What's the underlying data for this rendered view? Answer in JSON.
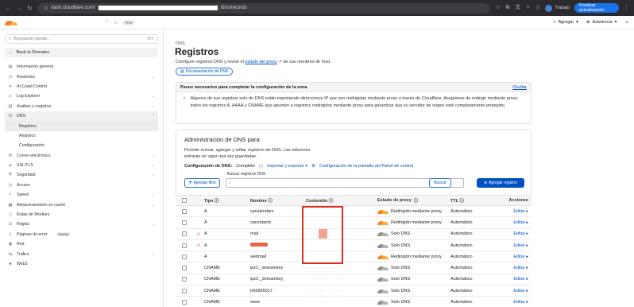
{
  "browser": {
    "url": "dash.cloudflare.com/",
    "url_suffix": "/dns/records",
    "profile": "Trabajo",
    "update_button": "Finalizar actualización"
  },
  "topbar": {
    "plan_badge": "Free",
    "add_label": "Agregar",
    "support_label": "Asistencia"
  },
  "sidebar": {
    "search_placeholder": "Búsqueda rápida...",
    "search_shortcut": "⌘K",
    "back_label": "Back to Domains",
    "items": [
      {
        "label": "Información general",
        "icon": "doc-icon"
      },
      {
        "label": "Recientes",
        "icon": "clock-icon",
        "chevron": true
      },
      {
        "label": "AI Crawl Control",
        "icon": "ai-icon"
      },
      {
        "label": "Log Explorer",
        "icon": "log-icon",
        "chevron": true
      },
      {
        "label": "Análisis y registros",
        "icon": "chart-icon",
        "chevron": true
      },
      {
        "label": "DNS",
        "icon": "dns-icon",
        "chevron": true
      }
    ],
    "dns_sub": [
      "Registros",
      "Analytics",
      "Configuración"
    ],
    "items2": [
      {
        "label": "Correo electrónico",
        "icon": "mail-icon",
        "chevron": true
      },
      {
        "label": "SSL/TLS",
        "icon": "lock-icon",
        "chevron": true
      },
      {
        "label": "Seguridad",
        "icon": "shield-icon",
        "chevron": true
      },
      {
        "label": "Acceso",
        "icon": "access-icon"
      },
      {
        "label": "Speed",
        "icon": "speed-icon",
        "chevron": true
      },
      {
        "label": "Almacenamiento en caché",
        "icon": "cache-icon",
        "chevron": true
      },
      {
        "label": "Rutas de Workers",
        "icon": "workers-icon"
      },
      {
        "label": "Reglas",
        "icon": "rules-icon",
        "chevron": true
      },
      {
        "label": "Páginas de error",
        "icon": "error-icon",
        "badge": "Nuevo"
      },
      {
        "label": "Red",
        "icon": "network-icon"
      },
      {
        "label": "Tráfico",
        "icon": "traffic-icon",
        "chevron": true
      },
      {
        "label": "Web3",
        "icon": "web3-icon"
      }
    ]
  },
  "main": {
    "breadcrumb": "DNS",
    "title": "Registros",
    "subtitle_pre": "Configure registros DNS y revise el",
    "subtitle_link": "estado del proxy",
    "subtitle_post": "de sus nombres de host.",
    "doc_button": "Documentación de DNS",
    "notice": {
      "title": "Pasos necesarios para completar la configuración de la zona",
      "hide": "Ocultar",
      "body": "Algunos de sus registros solo de DNS están exponiendo direcciones IP que son redirigidas mediante proxy a través de Cloudflare. Asegúrese de redirigir mediante proxy todos los registros A, AAAA y CNAME que apunten a registros redirigidos mediante proxy para garantizar que su servidor de origen esté completamente protegido."
    },
    "card": {
      "title": "Administración de DNS para",
      "desc": "Permite revisar, agregar y editar registros de DNS. Las ediciones entrarán en vigor una vez guardadas.",
      "config_label": "Configuración de DNS:",
      "config_value": "Completo",
      "import_export": "Importar y exportar",
      "panel_config": "Configuración de la pantalla del Panel de control",
      "search_label": "Buscar registros DNS",
      "filter_button": "Agregar filtro",
      "search_button": "Buscar",
      "add_button": "Agregar registro"
    },
    "table": {
      "headers": {
        "type": "Tipo",
        "name": "Nombre",
        "content": "Contenido",
        "proxy": "Estado de proxy",
        "ttl": "TTL",
        "actions": "Acciones"
      },
      "edit_label": "Editar",
      "rows": [
        {
          "warn": false,
          "type": "A",
          "name": "cpcalendars",
          "proxy": "Redirigido mediante proxy",
          "proxied": true,
          "ttl": "Automático"
        },
        {
          "warn": false,
          "type": "A",
          "name": "cpcontacts",
          "proxy": "Redirigido mediante proxy",
          "proxied": true,
          "ttl": "Automático"
        },
        {
          "warn": true,
          "type": "A",
          "name": "mail",
          "proxy": "Solo DNS",
          "proxied": false,
          "ttl": "Automático"
        },
        {
          "warn": true,
          "type": "A",
          "name": "",
          "proxy": "Solo DNS",
          "proxied": false,
          "ttl": "Automático",
          "redacted": true
        },
        {
          "warn": false,
          "type": "A",
          "name": "webmail",
          "proxy": "Redirigido mediante proxy",
          "proxied": true,
          "ttl": "Automático"
        },
        {
          "warn": false,
          "type": "CNAME",
          "name": "ipz1._domainkey",
          "proxy": "Solo DNS",
          "proxied": false,
          "ttl": "Automático"
        },
        {
          "warn": false,
          "type": "CNAME",
          "name": "ipz2._domainkey",
          "proxy": "Solo DNS",
          "proxied": false,
          "ttl": "Automático"
        },
        {
          "warn": false,
          "type": "CNAME",
          "name": "tr69965017",
          "proxy": "Solo DNS",
          "proxied": false,
          "ttl": "Automático"
        },
        {
          "warn": false,
          "type": "CNAME",
          "name": "www",
          "proxy": "Solo DNS",
          "proxied": false,
          "ttl": "Automático"
        }
      ]
    }
  }
}
